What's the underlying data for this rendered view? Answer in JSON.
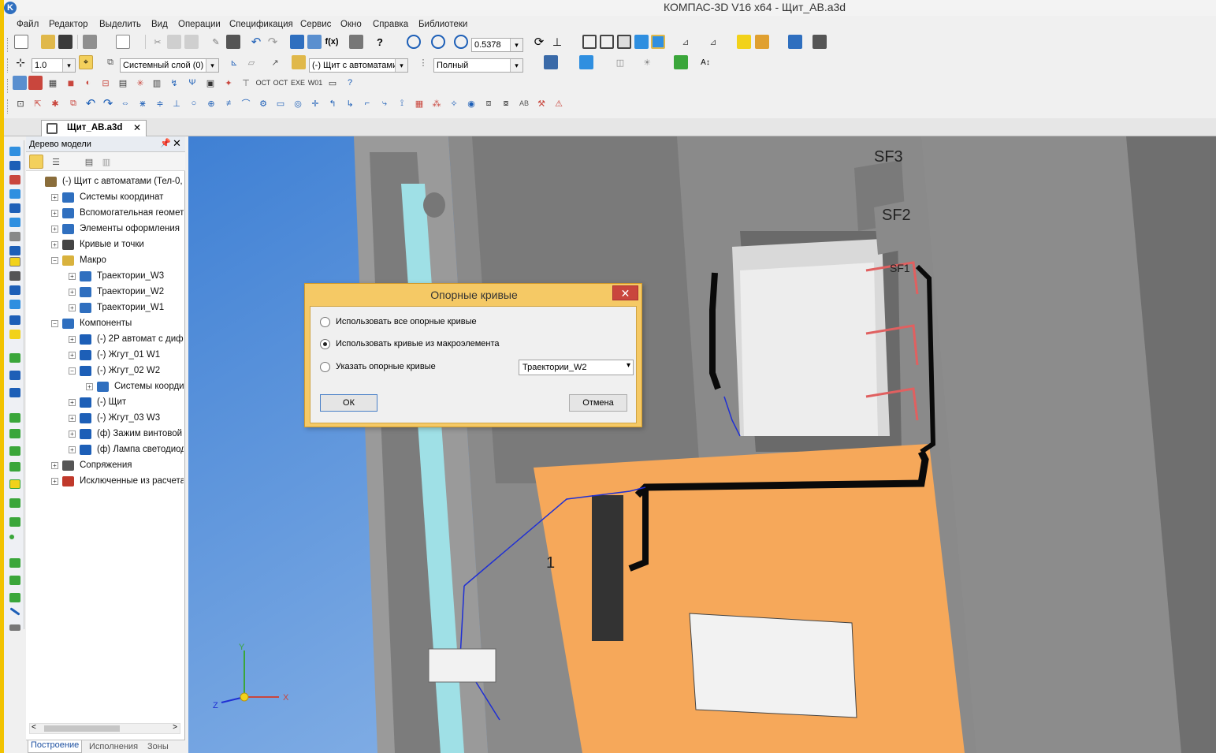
{
  "window": {
    "title": "КОМПАС-3D V16  x64 - Щит_АВ.a3d",
    "logo": "kompas-logo-icon"
  },
  "menu": [
    "Файл",
    "Редактор",
    "Выделить",
    "Вид",
    "Операции",
    "Спецификация",
    "Сервис",
    "Окно",
    "Справка",
    "Библиотеки"
  ],
  "toolbar": {
    "zoom_value": "0.5378",
    "step_value": "1.0",
    "layer_value": "Системный слой (0)",
    "filter_value": "(-) Щит с автоматами",
    "display_mode": "Полный"
  },
  "document_tab": {
    "label": "Щит_АВ.a3d",
    "close": "✕"
  },
  "tree": {
    "title": "Дерево модели",
    "pin": "📌",
    "close": "✕",
    "items": [
      {
        "label": "(-) Щит с автоматами (Тел-0,",
        "level": 0,
        "expander": "",
        "icon": "assembly-icon",
        "color": "#8a6d3b"
      },
      {
        "label": "Системы координат",
        "level": 1,
        "expander": "+",
        "icon": "coordinate-system-icon",
        "color": "#2f6fbf"
      },
      {
        "label": "Вспомогательная геомет",
        "level": 1,
        "expander": "+",
        "icon": "aux-geometry-icon",
        "color": "#2f6fbf"
      },
      {
        "label": "Элементы оформления",
        "level": 1,
        "expander": "+",
        "icon": "design-elements-icon",
        "color": "#2f6fbf"
      },
      {
        "label": "Кривые и точки",
        "level": 1,
        "expander": "+",
        "icon": "curves-icon",
        "color": "#444444"
      },
      {
        "label": "Макро",
        "level": 1,
        "expander": "−",
        "icon": "folder-icon",
        "color": "#d9b23d"
      },
      {
        "label": "Траектории_W3",
        "level": 2,
        "expander": "+",
        "icon": "trajectory-icon",
        "color": "#2f6fbf"
      },
      {
        "label": "Траектории_W2",
        "level": 2,
        "expander": "+",
        "icon": "trajectory-icon",
        "color": "#2f6fbf"
      },
      {
        "label": "Траектории_W1",
        "level": 2,
        "expander": "+",
        "icon": "trajectory-icon",
        "color": "#2f6fbf"
      },
      {
        "label": "Компоненты",
        "level": 1,
        "expander": "−",
        "icon": "components-icon",
        "color": "#2f6fbf"
      },
      {
        "label": "(-) 2P автомат с диф.",
        "level": 2,
        "expander": "+",
        "icon": "part-icon",
        "color": "#1d5fb7"
      },
      {
        "label": "(-) Жгут_01 W1",
        "level": 2,
        "expander": "+",
        "icon": "part-icon",
        "color": "#1d5fb7"
      },
      {
        "label": "(-) Жгут_02 W2",
        "level": 2,
        "expander": "−",
        "icon": "part-icon",
        "color": "#1d5fb7"
      },
      {
        "label": "Системы коорди",
        "level": 3,
        "expander": "+",
        "icon": "coordinate-system-icon",
        "color": "#2f6fbf"
      },
      {
        "label": "(-) Щит",
        "level": 2,
        "expander": "+",
        "icon": "part-icon",
        "color": "#1d5fb7"
      },
      {
        "label": "(-) Жгут_03 W3",
        "level": 2,
        "expander": "+",
        "icon": "part-icon",
        "color": "#1d5fb7"
      },
      {
        "label": "(ф) Зажим винтовой",
        "level": 2,
        "expander": "+",
        "icon": "library-part-icon",
        "color": "#1d5fb7"
      },
      {
        "label": "(ф) Лампа светодиод",
        "level": 2,
        "expander": "+",
        "icon": "library-part-icon",
        "color": "#1d5fb7"
      },
      {
        "label": "Сопряжения",
        "level": 1,
        "expander": "+",
        "icon": "constraints-icon",
        "color": "#555555"
      },
      {
        "label": "Исключенные из расчета",
        "level": 1,
        "expander": "+",
        "icon": "excluded-icon",
        "color": "#c0392b"
      }
    ],
    "tabs": [
      "Построение",
      "Исполнения",
      "Зоны"
    ],
    "scroll_left": "<",
    "scroll_right": ">"
  },
  "viewport": {
    "labels": [
      "SF3",
      "SF2",
      "SF1",
      "1"
    ],
    "axes": {
      "x": "X",
      "y": "Y",
      "z": "Z"
    },
    "colors": {
      "background": "#4f8fd8",
      "panel": "#f6a85a",
      "cabinet": "#8c8c8c",
      "wire": "#0a0a0a",
      "trajectory": "#1f2fd4"
    }
  },
  "dialog": {
    "title": "Опорные кривые",
    "close": "✕",
    "options": [
      {
        "label": "Использовать все опорные кривые",
        "checked": false
      },
      {
        "label": "Использовать кривые из макроэлемента",
        "checked": true
      },
      {
        "label": "Указать опорные кривые",
        "checked": false
      }
    ],
    "macro_select": {
      "value": "Траектории_W2",
      "arrow": "▾"
    },
    "ok_label": "ОК",
    "cancel_label": "Отмена"
  }
}
